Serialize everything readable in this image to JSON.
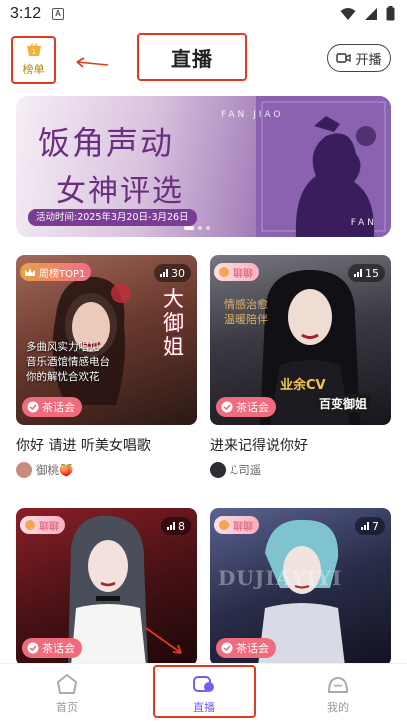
{
  "status": {
    "time": "3:12",
    "notif_icon": "A"
  },
  "header": {
    "rank_label": "榜单",
    "title": "直播",
    "live_button": "开播"
  },
  "banner": {
    "title_line1": "饭角声动",
    "title_line2": "女神评选",
    "date": "活动时间:2025年3月20日-3月26日",
    "brand_top": "FAN JIAO",
    "brand_bottom": "FAN"
  },
  "cards": [
    {
      "badge": "周榜TOP1",
      "count": "30",
      "tag": "茶话会",
      "title": "你好 请进 听美女唱歌",
      "user": "御桃🍑",
      "bg": "#6b3a2e",
      "overlay_text": "大御姐",
      "poster_lines": [
        "多曲风实力唱见",
        "音乐酒馆情感电台",
        "你的解忧合欢花"
      ]
    },
    {
      "badge": "聊聊",
      "count": "15",
      "tag": "茶话会",
      "title": "进来记得说你好",
      "user": "ℒ司遥",
      "bg": "#3b3942",
      "overlay_text": "业余CV",
      "overlay_text2": "百变御姐",
      "poster_lines": [
        "情感治愈",
        "温暖陪伴"
      ]
    },
    {
      "badge": "",
      "count": "8",
      "tag": "茶话会",
      "title": "",
      "user": "",
      "bg": "#4a1216"
    },
    {
      "badge": "聊聊",
      "count": "7",
      "tag": "茶话会",
      "title": "",
      "user": "",
      "bg": "#2a2d4a",
      "overlay_text": "DUJIAYIYI"
    }
  ],
  "nav": [
    {
      "label": "首页",
      "icon": "home-icon",
      "active": false
    },
    {
      "label": "直播",
      "icon": "live-icon",
      "active": true
    },
    {
      "label": "我的",
      "icon": "profile-icon",
      "active": false
    }
  ],
  "colors": {
    "accent": "#7b5cf0",
    "annotation": "#e23a1f",
    "tag": "#f06c7c"
  }
}
